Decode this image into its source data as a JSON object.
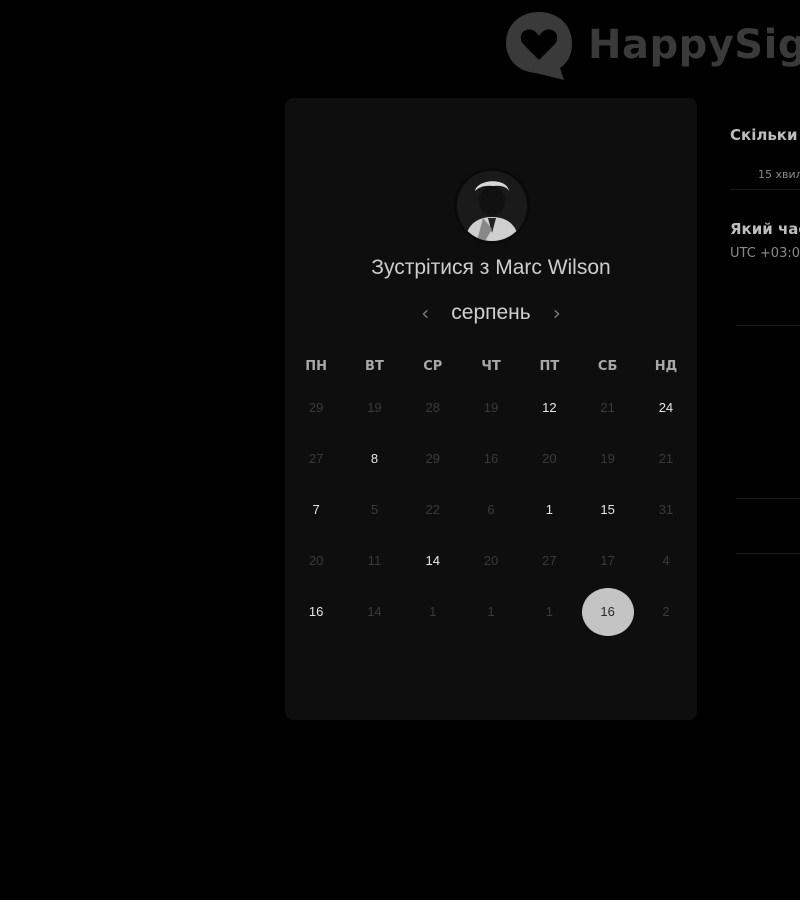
{
  "brand": {
    "name": "HappySig"
  },
  "card": {
    "title": "Зустрітися з Marc Wilson",
    "month": "серпень",
    "prev_icon": "‹",
    "next_icon": "›",
    "weekdays": [
      "ПН",
      "ВТ",
      "СР",
      "ЧТ",
      "ПТ",
      "СБ",
      "НД"
    ],
    "weeks": [
      [
        {
          "d": "29",
          "a": false
        },
        {
          "d": "19",
          "a": false
        },
        {
          "d": "28",
          "a": false
        },
        {
          "d": "19",
          "a": false
        },
        {
          "d": "12",
          "a": true
        },
        {
          "d": "21",
          "a": false
        },
        {
          "d": "24",
          "a": true
        }
      ],
      [
        {
          "d": "27",
          "a": false
        },
        {
          "d": "8",
          "a": true
        },
        {
          "d": "29",
          "a": false
        },
        {
          "d": "16",
          "a": false
        },
        {
          "d": "20",
          "a": false
        },
        {
          "d": "19",
          "a": false
        },
        {
          "d": "21",
          "a": false
        }
      ],
      [
        {
          "d": "7",
          "a": true
        },
        {
          "d": "5",
          "a": false
        },
        {
          "d": "22",
          "a": false
        },
        {
          "d": "6",
          "a": false
        },
        {
          "d": "1",
          "a": true
        },
        {
          "d": "15",
          "a": true
        },
        {
          "d": "31",
          "a": false
        }
      ],
      [
        {
          "d": "20",
          "a": false
        },
        {
          "d": "11",
          "a": false
        },
        {
          "d": "14",
          "a": true
        },
        {
          "d": "20",
          "a": false
        },
        {
          "d": "27",
          "a": false
        },
        {
          "d": "17",
          "a": false
        },
        {
          "d": "4",
          "a": false
        }
      ],
      [
        {
          "d": "16",
          "a": true
        },
        {
          "d": "14",
          "a": false
        },
        {
          "d": "1",
          "a": false
        },
        {
          "d": "1",
          "a": false
        },
        {
          "d": "1",
          "a": false
        },
        {
          "d": "16",
          "a": true,
          "selected": true
        },
        {
          "d": "2",
          "a": false
        }
      ]
    ]
  },
  "right_panel": {
    "question_duration": "Скільки",
    "duration_value": "15 хвил",
    "question_time": "Який час",
    "timezone": "UTC +03:0"
  },
  "colors": {
    "background": "#000000",
    "card": "#0e0e0e",
    "selected": "#c4c4c4"
  }
}
